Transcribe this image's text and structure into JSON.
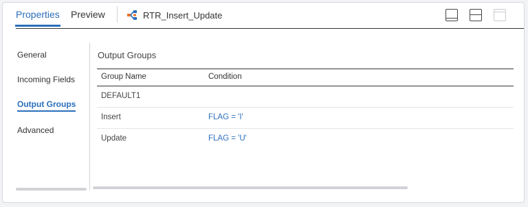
{
  "tabs": [
    {
      "label": "Properties",
      "active": true
    },
    {
      "label": "Preview",
      "active": false
    }
  ],
  "object": {
    "name": "RTR_Insert_Update",
    "icon": "router-transformation-icon"
  },
  "layout_buttons": [
    {
      "icon": "panel-bottom-layout-icon"
    },
    {
      "icon": "panel-split-layout-icon"
    },
    {
      "icon": "panel-top-layout-icon",
      "disabled": true
    }
  ],
  "sidebar": {
    "items": [
      {
        "label": "General",
        "active": false
      },
      {
        "label": "Incoming Fields",
        "active": false
      },
      {
        "label": "Output Groups",
        "active": true
      },
      {
        "label": "Advanced",
        "active": false
      }
    ]
  },
  "main": {
    "section_title": "Output Groups",
    "columns": [
      "Group Name",
      "Condition"
    ],
    "rows": [
      {
        "name": "DEFAULT1",
        "condition": ""
      },
      {
        "name": "Insert",
        "condition": "FLAG = 'I'"
      },
      {
        "name": "Update",
        "condition": "FLAG = 'U'"
      }
    ]
  },
  "colors": {
    "accent": "#2a6ebb",
    "text": "#333333",
    "border": "#d6d8dc"
  }
}
